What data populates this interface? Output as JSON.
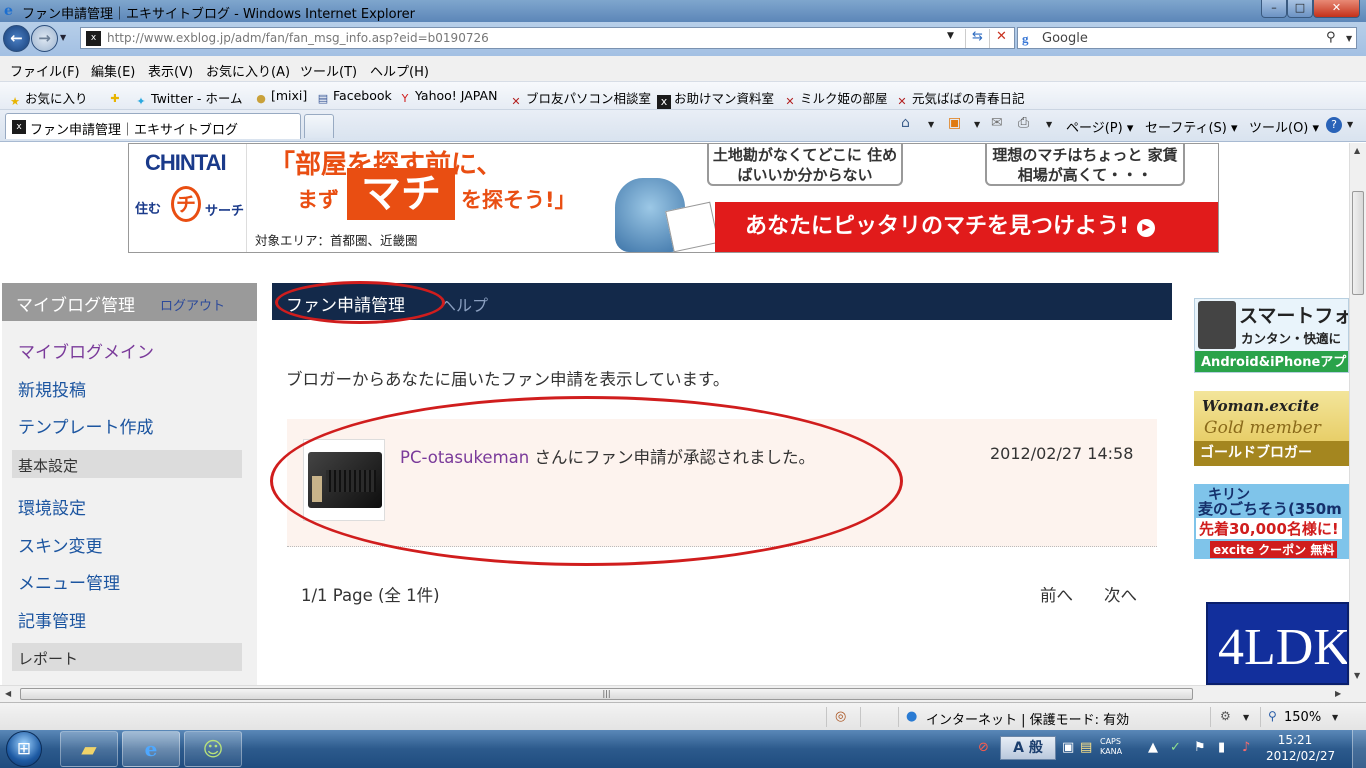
{
  "window": {
    "title": "ファン申請管理｜エキサイトブログ - Windows Internet Explorer",
    "min_glyph": "–",
    "max_glyph": "□",
    "close_glyph": "✕"
  },
  "browser": {
    "url": "http://www.exblog.jp/adm/fan/fan_msg_info.asp?eid=b0190726",
    "search_placeholder": "Google",
    "menu": [
      "ファイル(F)",
      "編集(E)",
      "表示(V)",
      "お気に入り(A)",
      "ツール(T)",
      "ヘルプ(H)"
    ],
    "favorites_label": "お気に入り",
    "favorites": [
      "Twitter - ホーム",
      "[mixi]",
      "Facebook",
      "Yahoo! JAPAN",
      "ブロ友パソコン相談室",
      "お助けマン資料室",
      "ミルク姫の部屋",
      "元気ばばの青春日記"
    ],
    "tab_title": "ファン申請管理｜エキサイトブログ",
    "commands": {
      "page": "ページ(P)",
      "safety": "セーフティ(S)",
      "tools": "ツール(O)"
    }
  },
  "banner": {
    "brand": "CHINTAI",
    "logo_sub_left": "住む",
    "logo_mark": "マチ",
    "logo_sub_right": "サーチ",
    "headline_top": "「部屋を探す前に、",
    "headline_prefix": "まず",
    "headline_emphasis": "マチ",
    "headline_suffix": "を探そう!」",
    "area": "対象エリア：首都圏、近畿圏",
    "bubble_left": "土地勘がなくてどこに 住めばいいか分からない",
    "bubble_right": "理想のマチはちょっと 家賃相場が高くて・・・",
    "cta": "あなたにピッタリのマチを見つけよう!"
  },
  "sidebar": {
    "title": "マイブログ管理",
    "logout": "ログアウト",
    "links_top": [
      "マイブログメイン",
      "新規投稿",
      "テンプレート作成"
    ],
    "section_basic": "基本設定",
    "links_basic": [
      "環境設定",
      "スキン変更",
      "メニュー管理",
      "記事管理"
    ],
    "section_report": "レポート"
  },
  "content": {
    "header_title": "ファン申請管理",
    "header_help": "ヘルプ",
    "intro": "ブロガーからあなたに届いたファン申請を表示しています。",
    "notices": [
      {
        "user": "PC-otasukeman",
        "message": " さんにファン申請が承認されました。",
        "date": "2012/02/27 14:58"
      }
    ],
    "pager": "1/1 Page (全 1件)",
    "prev": "前へ",
    "next": "次へ"
  },
  "side_ads": {
    "smart_title": "スマートフォ",
    "smart_sub": "カンタン・快適に",
    "smart_foot": "Android&iPhoneアプ",
    "woman_brand": "Woman.excite",
    "woman_gold": "Gold member",
    "woman_foot": "ゴールドブロガー",
    "kirin_brand": "キリン",
    "kirin_line": "麦のごちそう(350m",
    "kirin_offer": "先着30,000名様に!",
    "kirin_foot": "excite クーポン 無料",
    "ldk": "4LDK"
  },
  "statusbar": {
    "zone": "インターネット | 保護モード: 有効",
    "zoom": "150%"
  },
  "taskbar": {
    "ime": "A 般",
    "caps": "CAPS KANA",
    "time": "15:21",
    "date": "2012/02/27"
  },
  "icons": {
    "back": "back-arrow-icon",
    "forward": "forward-arrow-icon",
    "refresh": "refresh-icon",
    "stop": "stop-icon",
    "search": "magnifier-icon",
    "home": "home-icon",
    "feeds": "rss-icon",
    "mail": "mail-icon",
    "print": "printer-icon",
    "help": "help-icon"
  },
  "colors": {
    "content_header_bg": "#13294a",
    "annotation_red": "#d01d1d",
    "notice_bg": "#fdf3ee",
    "visited_link": "#7a3a9a",
    "link": "#1c55a0"
  }
}
